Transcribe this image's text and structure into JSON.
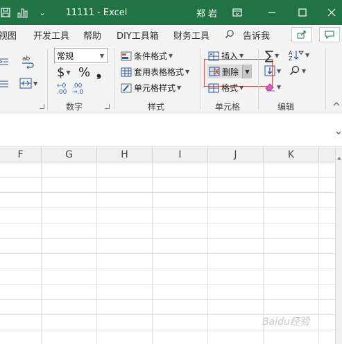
{
  "titlebar": {
    "title": "11111  -  Excel",
    "user": "郑 岩",
    "qat_caret": "⌄"
  },
  "tabs": [
    "视图",
    "开发工具",
    "帮助",
    "DIY工具箱",
    "财务工具",
    "告诉我"
  ],
  "ribbon": {
    "number_format": "常规",
    "currency": "$",
    "percent": "%",
    "comma": "❟",
    "dec_increase": "←0\n.00",
    "dec_decrease": ".00\n→.0",
    "groups": {
      "number": "数字",
      "styles": "样式",
      "cells": "单元格",
      "editing": "编辑"
    },
    "styles": {
      "conditional": "条件格式",
      "table": "套用表格格式",
      "cell": "单元格样式"
    },
    "cells": {
      "insert": "插入",
      "delete": "删除",
      "format": "格式"
    }
  },
  "columns": [
    "F",
    "G",
    "H",
    "I",
    "J",
    "K"
  ],
  "watermark": "Baidu经验",
  "colors": {
    "excel_green": "#217346",
    "highlight": "#d9534f"
  }
}
